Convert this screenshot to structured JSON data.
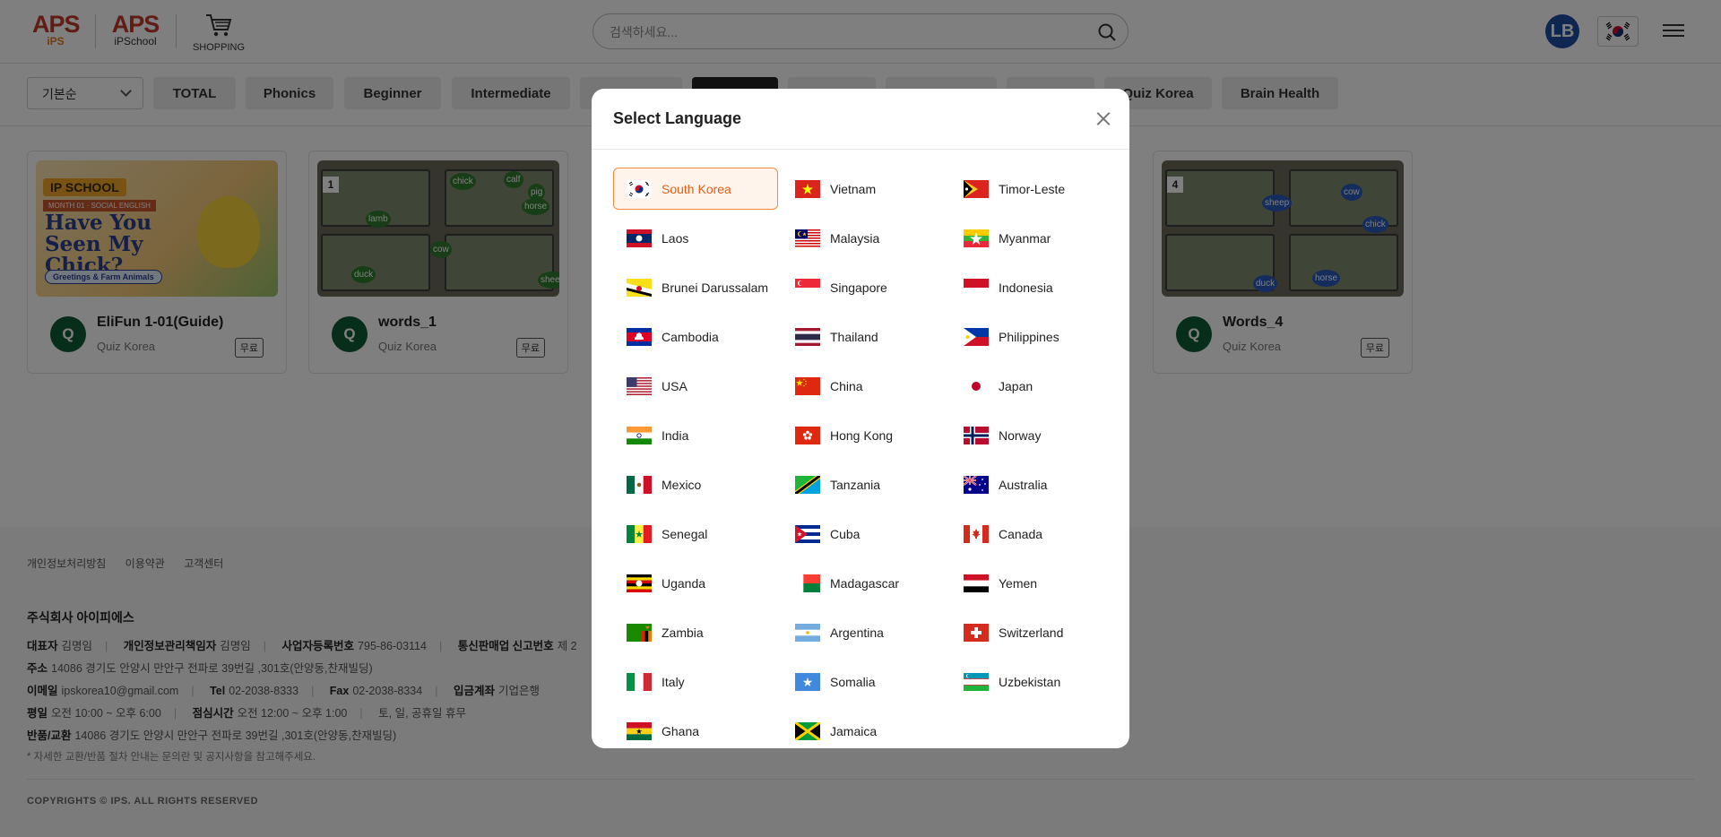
{
  "header": {
    "logos": [
      {
        "mark": "APS",
        "sub": "iPS"
      },
      {
        "mark": "APS",
        "sub": "iPSchool"
      },
      {
        "mark": "cart-icon",
        "sub": "SHOPPING"
      }
    ],
    "search_placeholder": "검색하세요...",
    "avatar_initials": "LB",
    "current_flag": "South Korea"
  },
  "categories": {
    "sort_label": "기본순",
    "items": [
      "TOTAL",
      "Phonics",
      "Beginner",
      "Intermediate"
    ],
    "trailing_items": [
      "Quiz Korea",
      "Brain Health"
    ]
  },
  "cards": [
    {
      "title": "EliFun 1-01(Guide)",
      "maker": "Quiz Korea",
      "price": "무료",
      "thumb": {
        "badge": "IP SCHOOL",
        "sub": "MONTH 01 · SOCIAL ENGLISH",
        "title": "Have You Seen My Chick?",
        "pill": "Greetings & Farm Animals"
      }
    },
    {
      "title": "words_1",
      "maker": "Quiz Korea",
      "price": "무료",
      "thumb": {
        "num": "1",
        "words": [
          "chick",
          "calf",
          "pig",
          "horse",
          "lamb",
          "cow",
          "duck",
          "sheep"
        ]
      }
    },
    {
      "title": "Words_4",
      "maker": "Quiz Korea",
      "price": "무료",
      "thumb": {
        "num": "4",
        "words": [
          "sheep",
          "cow",
          "chick",
          "duck",
          "horse"
        ]
      }
    }
  ],
  "footer": {
    "links": [
      "개인정보처리방침",
      "이용약관",
      "고객센터"
    ],
    "company": "주식회사 아이피에스",
    "line1": [
      {
        "label": "대표자",
        "value": "김명임"
      },
      {
        "label": "개인정보관리책임자",
        "value": "김명임"
      },
      {
        "label": "사업자등록번호",
        "value": "795-86-03114"
      },
      {
        "label": "통신판매업 신고번호",
        "value": "제 2"
      }
    ],
    "address": {
      "label": "주소",
      "value": "14086 경기도 안양시 만안구 전파로 39번길 ,301호(안양동,찬재빌딩)"
    },
    "line3": [
      {
        "label": "이메일",
        "value": "ipskorea10@gmail.com"
      },
      {
        "label": "Tel",
        "value": "02-2038-8333"
      },
      {
        "label": "Fax",
        "value": "02-2038-8334"
      },
      {
        "label": "입금계좌",
        "value": "기업은행"
      }
    ],
    "hours": [
      {
        "label": "평일",
        "value": "오전 10:00 ~ 오후 6:00"
      },
      {
        "label": "점심시간",
        "value": "오전 12:00 ~ 오후 1:00"
      },
      {
        "label": "",
        "value": "토, 일, 공휴일 휴무"
      }
    ],
    "returns": {
      "label": "반품/교환",
      "value": "14086 경기도 안양시 만안구 전파로 39번길 ,301호(안양동,찬재빌딩)"
    },
    "note": "* 자세한 교환/반품 절차 안내는 문의란 및 공지사항을 참고해주세요.",
    "copyright": "COPYRIGHTS © IPS. ALL RIGHTS RESERVED"
  },
  "modal": {
    "title": "Select Language",
    "selected": "South Korea",
    "languages": [
      "South Korea",
      "Vietnam",
      "Timor-Leste",
      "Laos",
      "Malaysia",
      "Myanmar",
      "Brunei Darussalam",
      "Singapore",
      "Indonesia",
      "Cambodia",
      "Thailand",
      "Philippines",
      "USA",
      "China",
      "Japan",
      "India",
      "Hong Kong",
      "Norway",
      "Mexico",
      "Tanzania",
      "Australia",
      "Senegal",
      "Cuba",
      "Canada",
      "Uganda",
      "Madagascar",
      "Yemen",
      "Zambia",
      "Argentina",
      "Switzerland",
      "Italy",
      "Somalia",
      "Uzbekistan",
      "Ghana",
      "Jamaica"
    ]
  },
  "colors": {
    "accent": "#f0883e",
    "avatar": "#1f4fa0",
    "quiz_badge": "#0f5a37",
    "overlay": "rgba(0,0,0,0.5)"
  }
}
